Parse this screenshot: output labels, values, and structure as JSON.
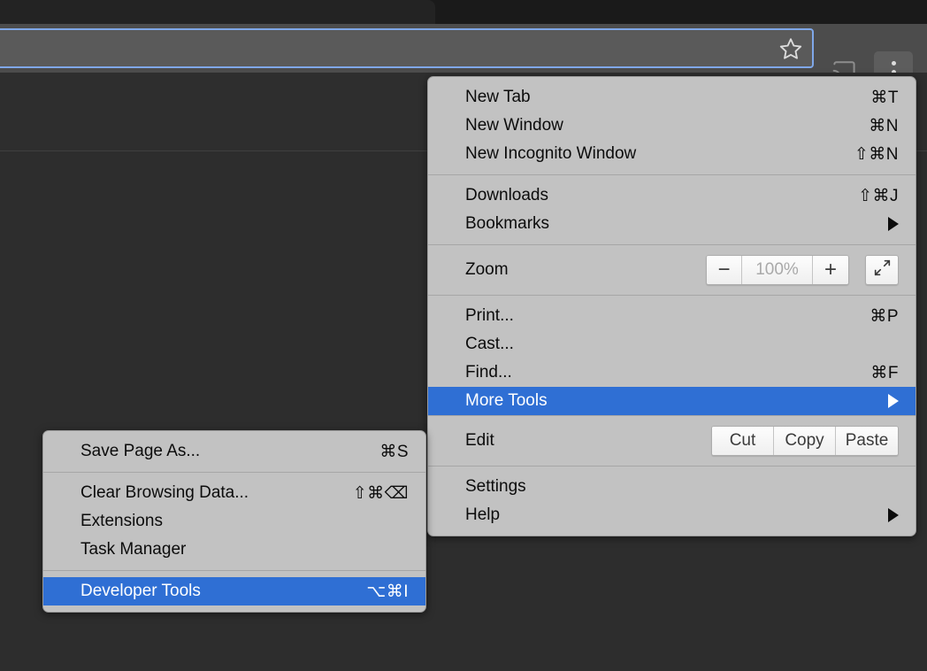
{
  "browser": {
    "omnibox": {
      "value": "",
      "placeholder": ""
    },
    "bookmark_star_icon": "star-outline-icon",
    "cast_icon": "cast-icon",
    "menu_icon": "three-dot-menu-icon"
  },
  "colors": {
    "highlight_blue": "#2f6fd4",
    "menu_background": "#c2c2c2",
    "page_background": "#2d2d2d",
    "toolbar_background": "#4c4c4c",
    "omnibox_focus_border": "#7fa7e8"
  },
  "main_menu": {
    "groups": [
      {
        "items": [
          {
            "label": "New Tab",
            "shortcut": "⌘T",
            "highlighted": false,
            "submenu_arrow": false
          },
          {
            "label": "New Window",
            "shortcut": "⌘N",
            "highlighted": false,
            "submenu_arrow": false
          },
          {
            "label": "New Incognito Window",
            "shortcut": "⇧⌘N",
            "highlighted": false,
            "submenu_arrow": false
          }
        ]
      },
      {
        "items": [
          {
            "label": "Downloads",
            "shortcut": "⇧⌘J",
            "highlighted": false,
            "submenu_arrow": false
          },
          {
            "label": "Bookmarks",
            "shortcut": "",
            "highlighted": false,
            "submenu_arrow": true
          }
        ]
      },
      {
        "zoom_row": {
          "label": "Zoom",
          "minus_label": "−",
          "value": "100%",
          "plus_label": "+",
          "fullscreen_icon": "fullscreen-expand-icon"
        }
      },
      {
        "items": [
          {
            "label": "Print...",
            "shortcut": "⌘P",
            "highlighted": false,
            "submenu_arrow": false
          },
          {
            "label": "Cast...",
            "shortcut": "",
            "highlighted": false,
            "submenu_arrow": false
          },
          {
            "label": "Find...",
            "shortcut": "⌘F",
            "highlighted": false,
            "submenu_arrow": false
          },
          {
            "label": "More Tools",
            "shortcut": "",
            "highlighted": true,
            "submenu_arrow": true
          }
        ]
      },
      {
        "edit_row": {
          "label": "Edit",
          "cut_label": "Cut",
          "copy_label": "Copy",
          "paste_label": "Paste"
        }
      },
      {
        "items": [
          {
            "label": "Settings",
            "shortcut": "",
            "highlighted": false,
            "submenu_arrow": false
          },
          {
            "label": "Help",
            "shortcut": "",
            "highlighted": false,
            "submenu_arrow": true
          }
        ]
      }
    ]
  },
  "submenu": {
    "groups": [
      {
        "items": [
          {
            "label": "Save Page As...",
            "shortcut": "⌘S",
            "highlighted": false
          }
        ]
      },
      {
        "items": [
          {
            "label": "Clear Browsing Data...",
            "shortcut": "⇧⌘⌫",
            "highlighted": false
          },
          {
            "label": "Extensions",
            "shortcut": "",
            "highlighted": false
          },
          {
            "label": "Task Manager",
            "shortcut": "",
            "highlighted": false
          }
        ]
      },
      {
        "items": [
          {
            "label": "Developer Tools",
            "shortcut": "⌥⌘I",
            "highlighted": true
          }
        ]
      }
    ]
  }
}
